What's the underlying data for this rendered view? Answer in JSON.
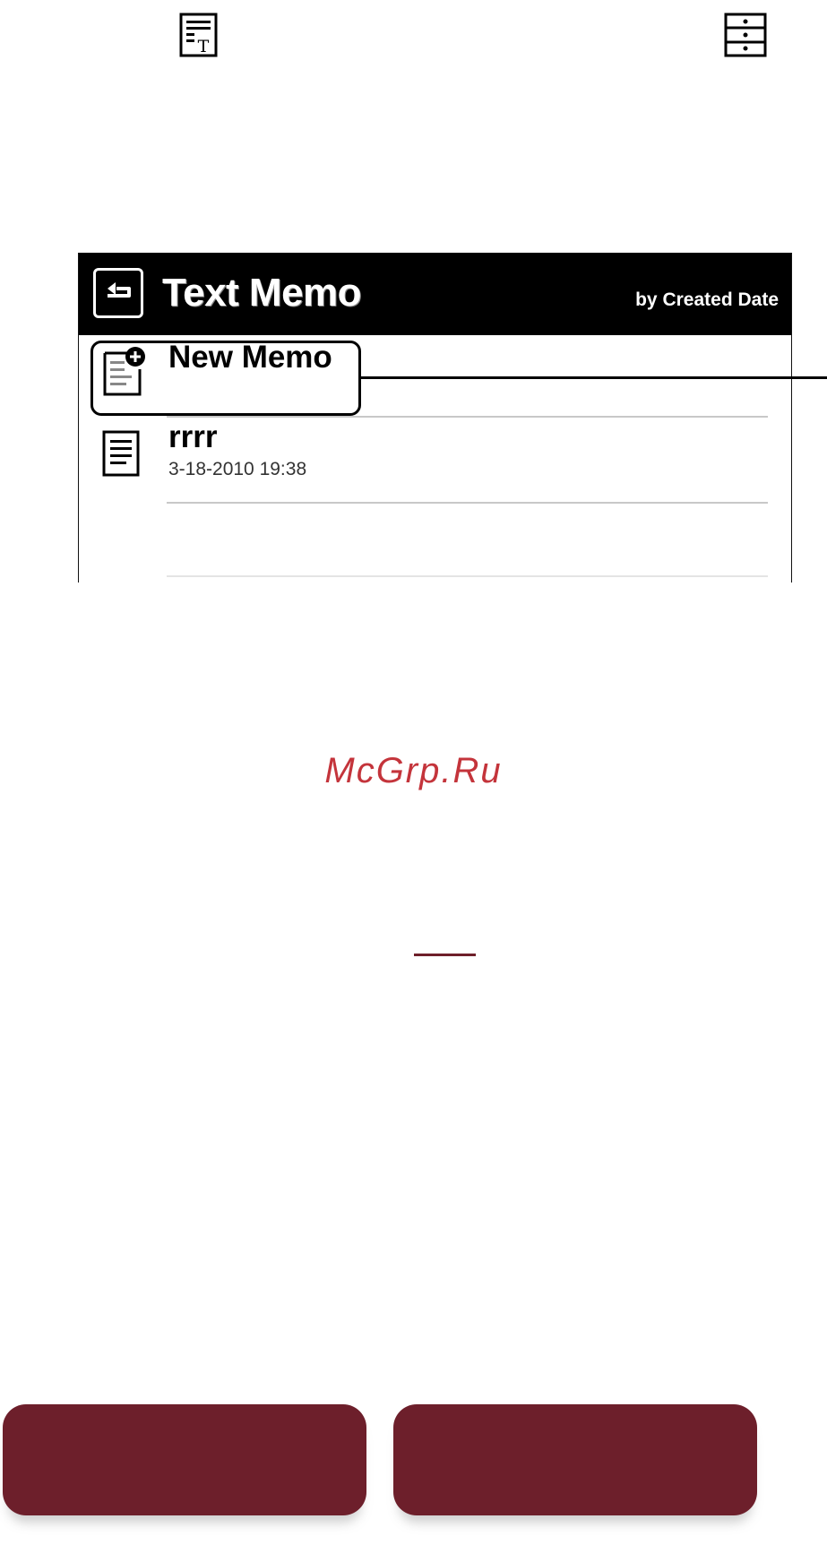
{
  "header_icons": [
    "text-memo-icon",
    "drawer-icon"
  ],
  "screen": {
    "title": "Text Memo",
    "sort_label": "by Created Date",
    "new_memo_label": "New Memo",
    "memos": [
      {
        "title": "rrrr",
        "date": "3-18-2010 19:38"
      }
    ]
  },
  "watermark": "McGrp.Ru",
  "colors": {
    "titlebar": "#000000",
    "nav_button": "#6d1f2b",
    "watermark": "#c4343b"
  }
}
